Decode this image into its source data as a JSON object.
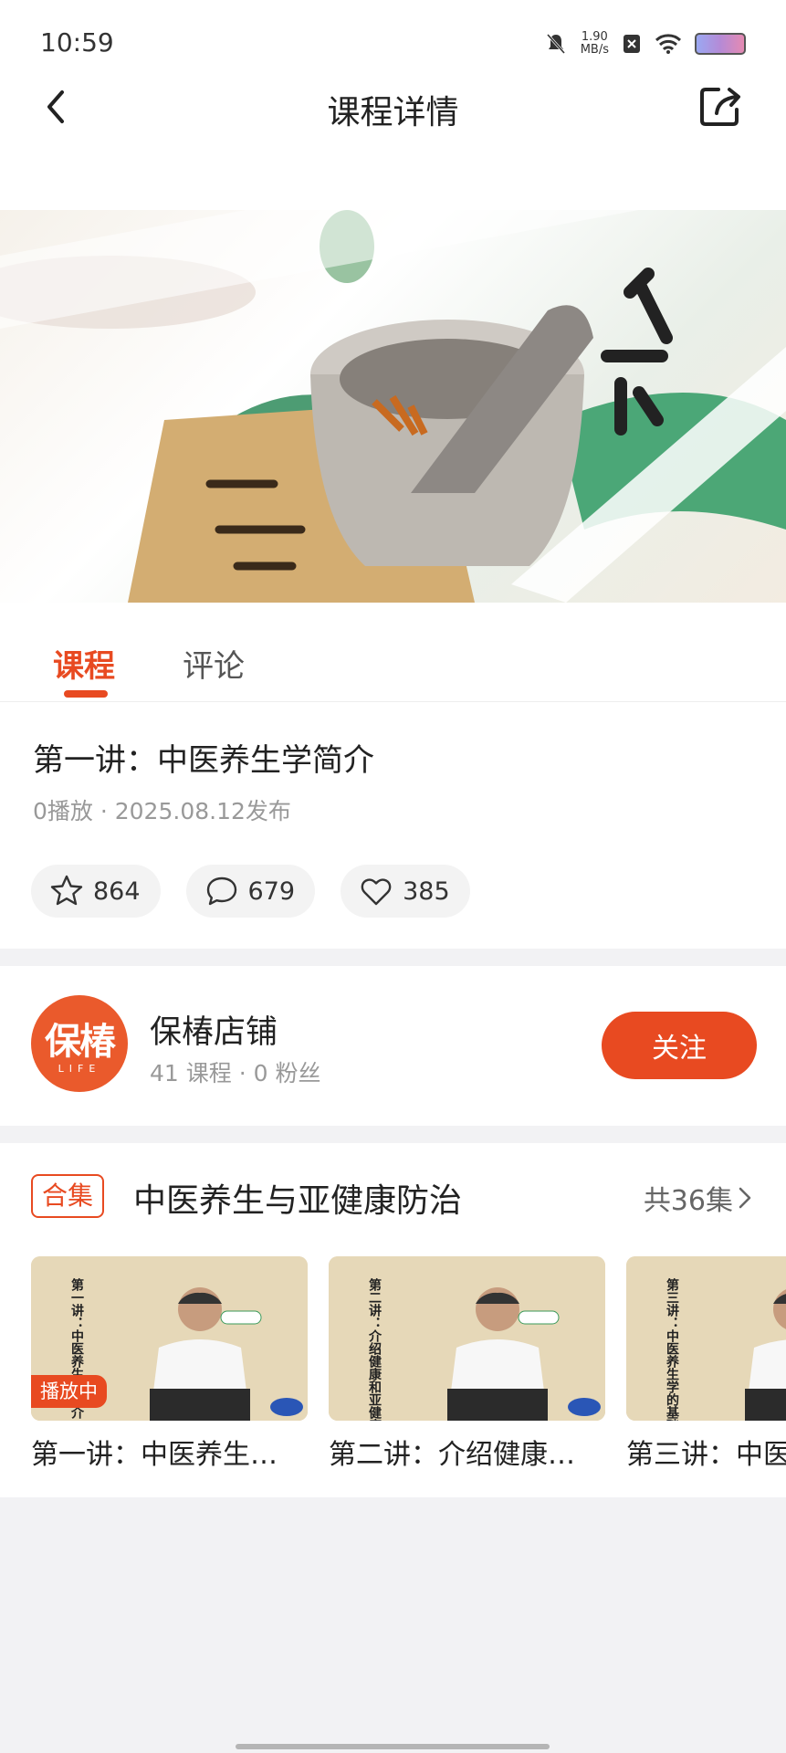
{
  "status_bar": {
    "time": "10:59",
    "net_speed_value": "1.90",
    "net_speed_unit": "MB/s"
  },
  "nav": {
    "title": "课程详情"
  },
  "tabs": [
    {
      "label": "课程"
    },
    {
      "label": "评论"
    }
  ],
  "course": {
    "title": "第一讲：中医养生学简介",
    "meta": "0播放 · 2025.08.12发布",
    "stats": {
      "favorites": "864",
      "comments": "679",
      "likes": "385"
    }
  },
  "shop": {
    "logo_text": "保椿",
    "logo_sub": "LIFE",
    "name": "保椿店铺",
    "meta": "41 课程 · 0 粉丝",
    "follow_label": "关注"
  },
  "collection": {
    "badge": "合集",
    "title": "中医养生与亚健康防治",
    "count": "共36集",
    "playing_label": "播放中",
    "episodes": [
      {
        "caption": "第一讲：中医养生…",
        "poster_text": "第一讲：中医养生学简介"
      },
      {
        "caption": "第二讲：介绍健康…",
        "poster_text": "第二讲：介绍健康和亚健康"
      },
      {
        "caption": "第三讲：中医",
        "poster_text": "第三讲：中医养生学的基础理论"
      }
    ]
  },
  "colors": {
    "accent": "#e84a21",
    "page_bg": "#f2f2f4"
  }
}
